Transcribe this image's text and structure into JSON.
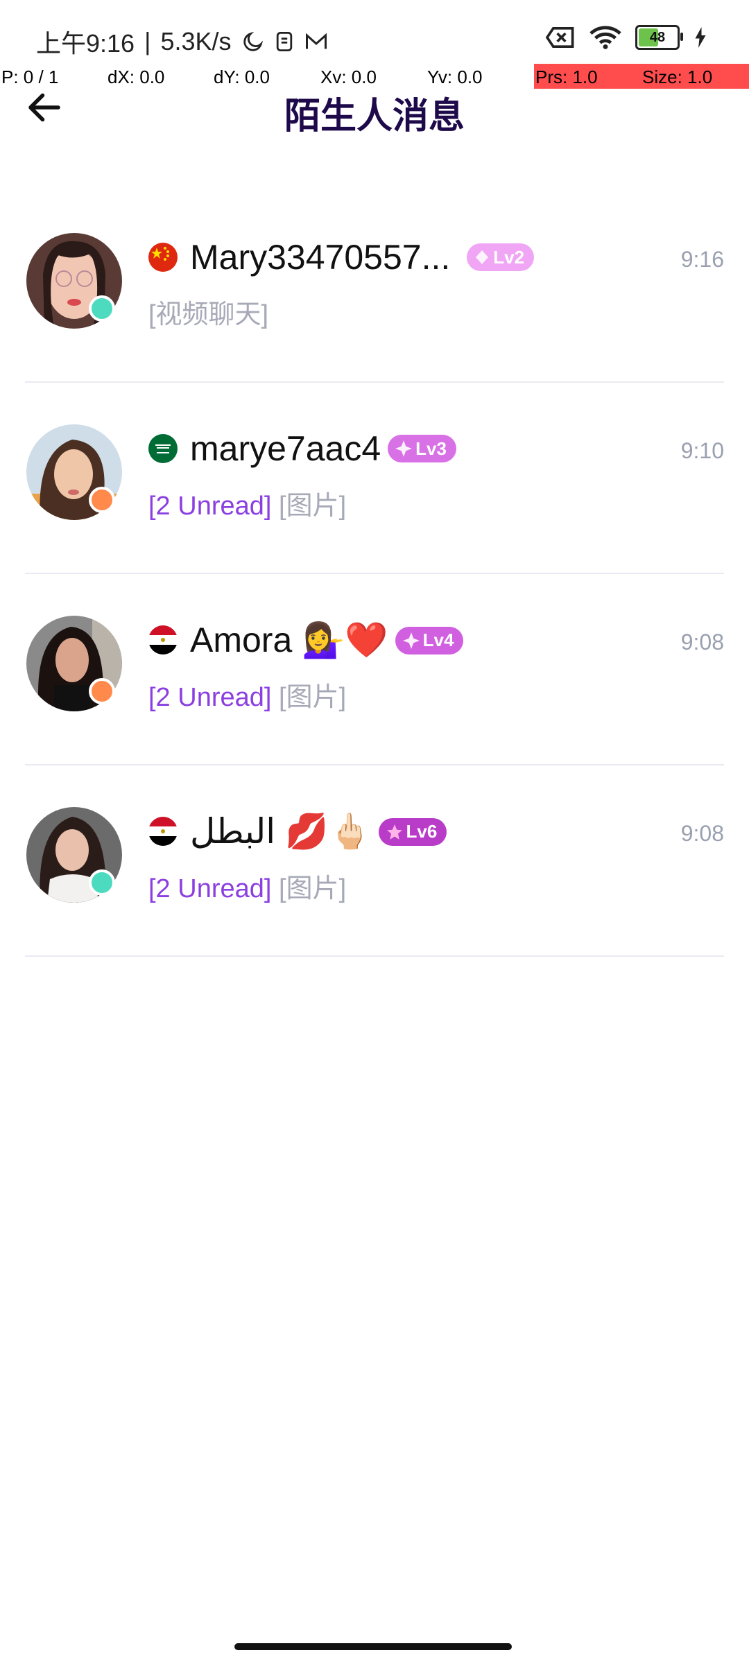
{
  "status_bar": {
    "time": "上午9:16",
    "net_speed": "5.3K/s",
    "battery": "48"
  },
  "debug": {
    "p": "P: 0 / 1",
    "dx": "dX: 0.0",
    "dy": "dY: 0.0",
    "xv": "Xv: 0.0",
    "yv": "Yv: 0.0",
    "prs": "Prs: 1.0",
    "size": "Size: 1.0"
  },
  "header": {
    "title": "陌生人消息"
  },
  "conversations": [
    {
      "name": "Mary33470557...",
      "level": "Lv2",
      "time": "9:16",
      "unread": "",
      "preview": "[视频聊天]",
      "flag": "china",
      "online": "teal"
    },
    {
      "name": "marye7aac4",
      "level": "Lv3",
      "time": "9:10",
      "unread": "[2 Unread]",
      "preview": "[图片]",
      "flag": "saudi",
      "online": "orange"
    },
    {
      "name": "Amora 💁‍♀️❤️",
      "level": "Lv4",
      "time": "9:08",
      "unread": "[2 Unread]",
      "preview": "[图片]",
      "flag": "egypt",
      "online": "orange"
    },
    {
      "name": "البطل 💋🖕🏻",
      "level": "Lv6",
      "time": "9:08",
      "unread": "[2 Unread]",
      "preview": "[图片]",
      "flag": "egypt",
      "online": "teal"
    }
  ],
  "colors": {
    "accent": "#8b3fe0",
    "title": "#1e0a4a",
    "online_teal": "#4ddbc0",
    "online_orange": "#ff8a4c",
    "badge_lv2": "#f0a6f5",
    "badge_lv3": "#d870e6",
    "badge_lv4": "#d060e0",
    "badge_lv6": "#b83cc8"
  }
}
